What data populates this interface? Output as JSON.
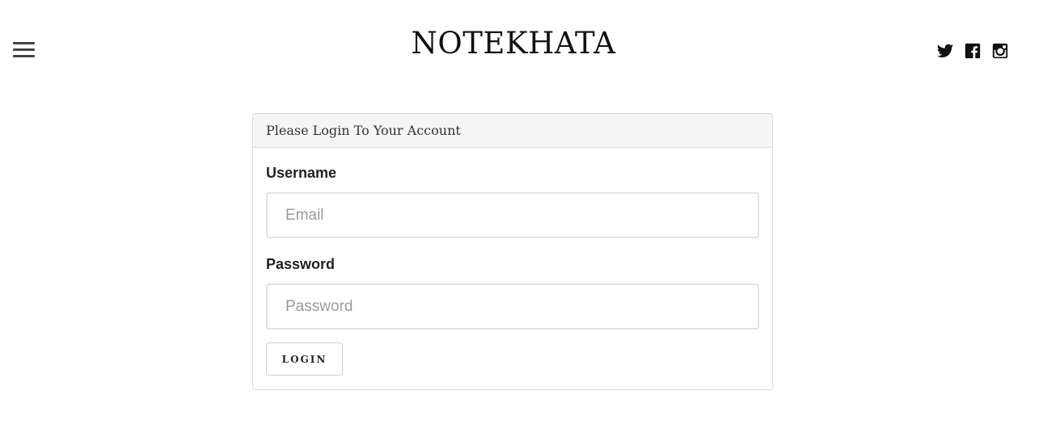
{
  "header": {
    "brand": "NOTEKHATA",
    "menu_icon": "hamburger-menu-icon",
    "social": [
      {
        "name": "twitter",
        "icon": "twitter-icon"
      },
      {
        "name": "facebook",
        "icon": "facebook-icon"
      },
      {
        "name": "instagram",
        "icon": "instagram-icon"
      }
    ]
  },
  "login_panel": {
    "heading": "Please Login To Your Account",
    "username_label": "Username",
    "username_placeholder": "Email",
    "password_label": "Password",
    "password_placeholder": "Password",
    "submit_label": "LOGIN"
  },
  "colors": {
    "panel_heading_bg": "#f5f5f5",
    "border": "#dddddd",
    "text": "#222222",
    "placeholder": "#9a9a9a"
  }
}
